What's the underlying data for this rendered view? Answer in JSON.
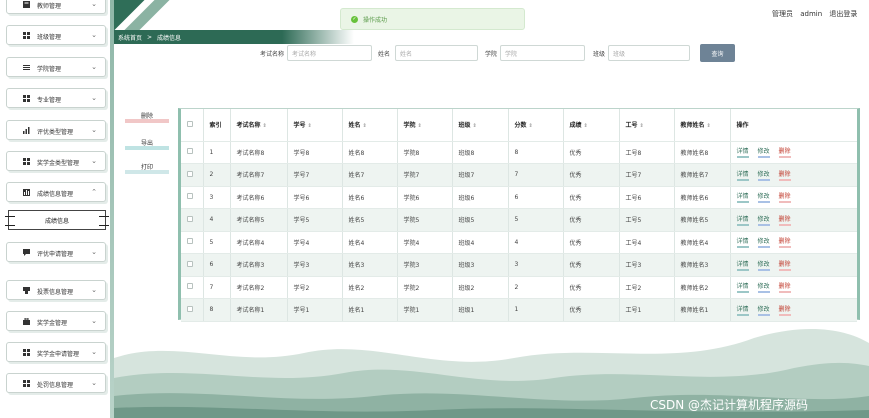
{
  "sidebar": {
    "items": [
      {
        "label": "教师管理",
        "icon": "user-card-icon"
      },
      {
        "label": "班级管理",
        "icon": "grid-icon"
      },
      {
        "label": "学院管理",
        "icon": "list-icon"
      },
      {
        "label": "专业管理",
        "icon": "grid-icon"
      },
      {
        "label": "评优类型管理",
        "icon": "bar-chart-icon"
      },
      {
        "label": "奖学金类型管理",
        "icon": "grid-icon"
      },
      {
        "label": "成绩信息管理",
        "icon": "chart-icon"
      },
      {
        "label": "评优申请管理",
        "icon": "chat-icon"
      },
      {
        "label": "投票信息管理",
        "icon": "vote-icon"
      },
      {
        "label": "奖学金管理",
        "icon": "briefcase-icon"
      },
      {
        "label": "奖学金申请管理",
        "icon": "grid-icon"
      },
      {
        "label": "处罚信息管理",
        "icon": "grid-icon"
      }
    ],
    "sub_item": "成绩信息"
  },
  "header": {
    "breadcrumb": [
      "系统首页",
      ">",
      "成绩信息"
    ],
    "toast": "操作成功",
    "user_role": "管理员",
    "user_name": "admin",
    "logout": "退出登录"
  },
  "search": {
    "fields": [
      {
        "label": "考试名称",
        "placeholder": "考试名称"
      },
      {
        "label": "姓名",
        "placeholder": "姓名"
      },
      {
        "label": "学院",
        "placeholder": "学院"
      },
      {
        "label": "班级",
        "placeholder": "班级"
      }
    ],
    "button": "查询"
  },
  "actions": {
    "delete": "删除",
    "export": "导出",
    "print": "打印"
  },
  "table": {
    "headers": [
      "索引",
      "考试名称",
      "学号",
      "姓名",
      "学院",
      "班级",
      "分数",
      "成绩",
      "工号",
      "教师姓名",
      "操作"
    ],
    "rows": [
      {
        "idx": "1",
        "exam": "考试名称8",
        "sid": "学号8",
        "name": "姓名8",
        "college": "学院8",
        "cls": "班级8",
        "score": "8",
        "grade": "优秀",
        "tid": "工号8",
        "teacher": "教师姓名8"
      },
      {
        "idx": "2",
        "exam": "考试名称7",
        "sid": "学号7",
        "name": "姓名7",
        "college": "学院7",
        "cls": "班级7",
        "score": "7",
        "grade": "优秀",
        "tid": "工号7",
        "teacher": "教师姓名7"
      },
      {
        "idx": "3",
        "exam": "考试名称6",
        "sid": "学号6",
        "name": "姓名6",
        "college": "学院6",
        "cls": "班级6",
        "score": "6",
        "grade": "优秀",
        "tid": "工号6",
        "teacher": "教师姓名6"
      },
      {
        "idx": "4",
        "exam": "考试名称5",
        "sid": "学号5",
        "name": "姓名5",
        "college": "学院5",
        "cls": "班级5",
        "score": "5",
        "grade": "优秀",
        "tid": "工号5",
        "teacher": "教师姓名5"
      },
      {
        "idx": "5",
        "exam": "考试名称4",
        "sid": "学号4",
        "name": "姓名4",
        "college": "学院4",
        "cls": "班级4",
        "score": "4",
        "grade": "优秀",
        "tid": "工号4",
        "teacher": "教师姓名4"
      },
      {
        "idx": "6",
        "exam": "考试名称3",
        "sid": "学号3",
        "name": "姓名3",
        "college": "学院3",
        "cls": "班级3",
        "score": "3",
        "grade": "优秀",
        "tid": "工号3",
        "teacher": "教师姓名3"
      },
      {
        "idx": "7",
        "exam": "考试名称2",
        "sid": "学号2",
        "name": "姓名2",
        "college": "学院2",
        "cls": "班级2",
        "score": "2",
        "grade": "优秀",
        "tid": "工号2",
        "teacher": "教师姓名2"
      },
      {
        "idx": "8",
        "exam": "考试名称1",
        "sid": "学号1",
        "name": "姓名1",
        "college": "学院1",
        "cls": "班级1",
        "score": "1",
        "grade": "优秀",
        "tid": "工号1",
        "teacher": "教师姓名1"
      }
    ],
    "ops": {
      "detail": "详情",
      "edit": "修改",
      "delete": "删除"
    }
  },
  "watermark": "CSDN @杰记计算机程序源码",
  "colors": {
    "primary": "#2f6e58",
    "table_alt": "#eef4f1",
    "search_button": "#6e8396",
    "toast_bg": "#eaf5e6"
  }
}
